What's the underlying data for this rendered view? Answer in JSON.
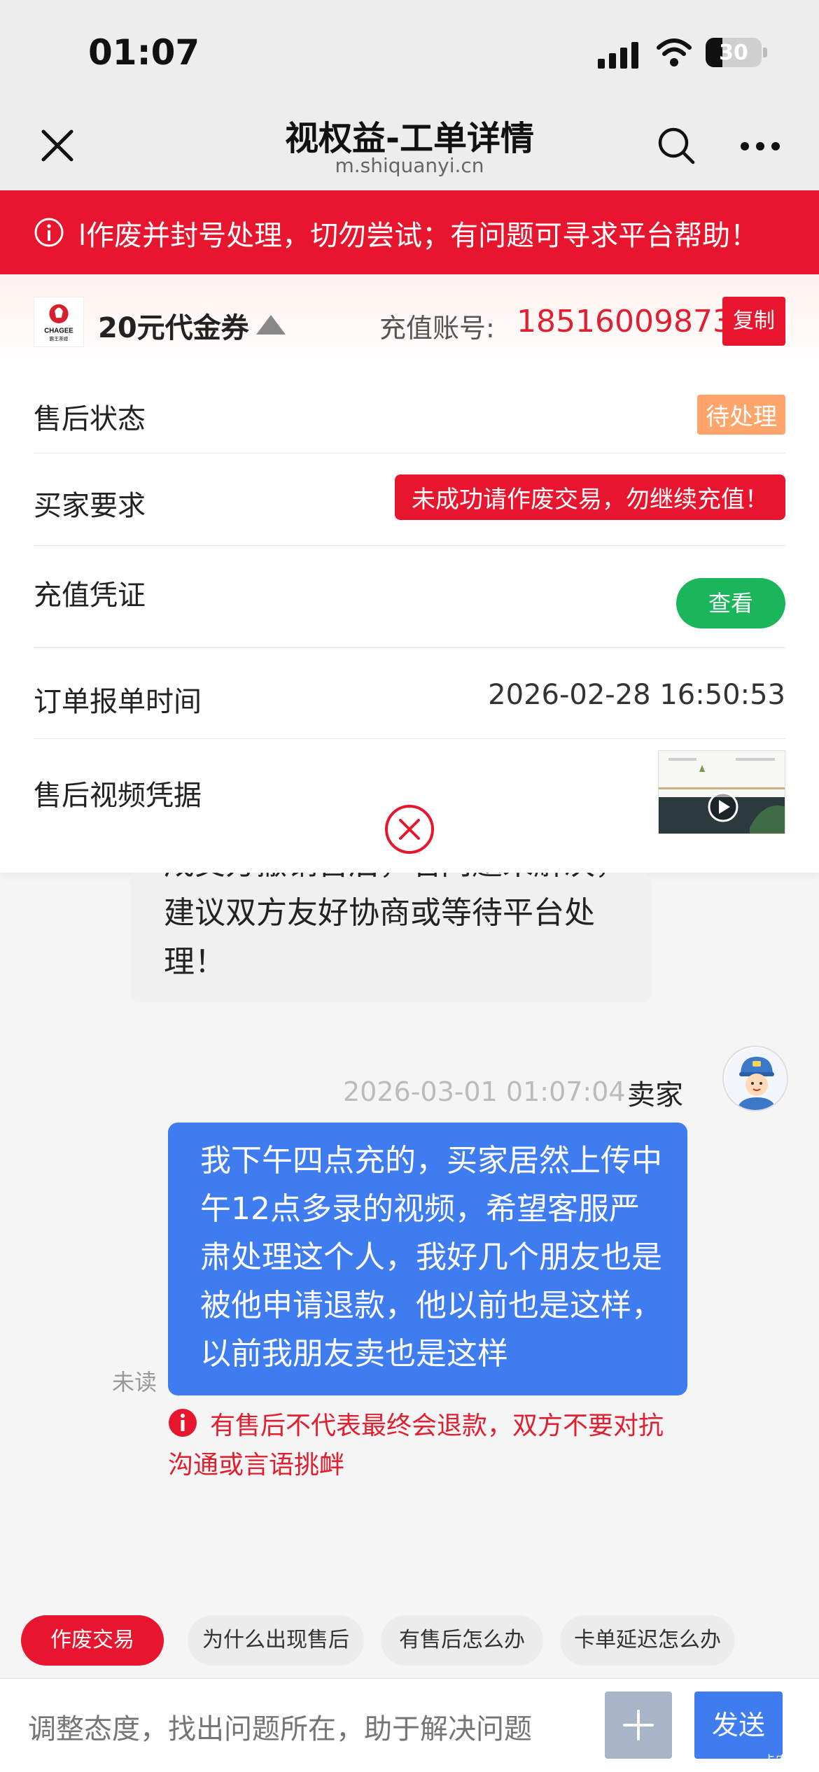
{
  "status_bar": {
    "time": "01:07",
    "battery": "30",
    "battery_level": 0.3
  },
  "nav": {
    "title": "视权益-工单详情",
    "subtitle": "m.shiquanyi.cn"
  },
  "banner": {
    "text": "l作废并封号处理，切勿尝试；有问题可寻求平台帮助！"
  },
  "product": {
    "logo_text": "CHAGEE",
    "logo_subtext": "霸王茶姬",
    "name": "20元代金券",
    "account_label": "充值账号:",
    "account_value": "18516009873",
    "copy_label": "复制"
  },
  "rows": {
    "status_label": "售后状态",
    "status_value": "待处理",
    "buyer_req_label": "买家要求",
    "buyer_req_value": "未成功请作废交易，勿继续充值！",
    "voucher_label": "充值凭证",
    "voucher_button": "查看",
    "time_label": "订单报单时间",
    "time_value": "2026-02-28 16:50:53",
    "video_label": "售后视频凭据"
  },
  "chat": {
    "gray_text": "成交方撤销售后，若问题未解决，建议双方友好协商或等待平台处理！",
    "msg_time": "2026-03-01 01:07:04",
    "msg_sender": "卖家",
    "msg_text": "我下午四点充的，买家居然上传中午12点多录的视频，希望客服严肃处理这个人，我好几个朋友也是被他申请退款，他以前也是这样，以前我朋友卖也是这样",
    "unread": "未读",
    "warning": "有售后不代表最终会退款，双方不要对抗沟通或言语挑衅"
  },
  "chips": [
    "作废交易",
    "为什么出现售后",
    "有售后怎么办",
    "卡单延迟怎么办"
  ],
  "input": {
    "placeholder": "调整态度，找出问题所在，助于解决问题",
    "send_label": "发送",
    "watermark": "卡农社区"
  },
  "colors": {
    "accent_red": "#e8152e",
    "blue": "#3f7cf0",
    "green": "#1bb55c",
    "orange": "#ffa46b"
  }
}
